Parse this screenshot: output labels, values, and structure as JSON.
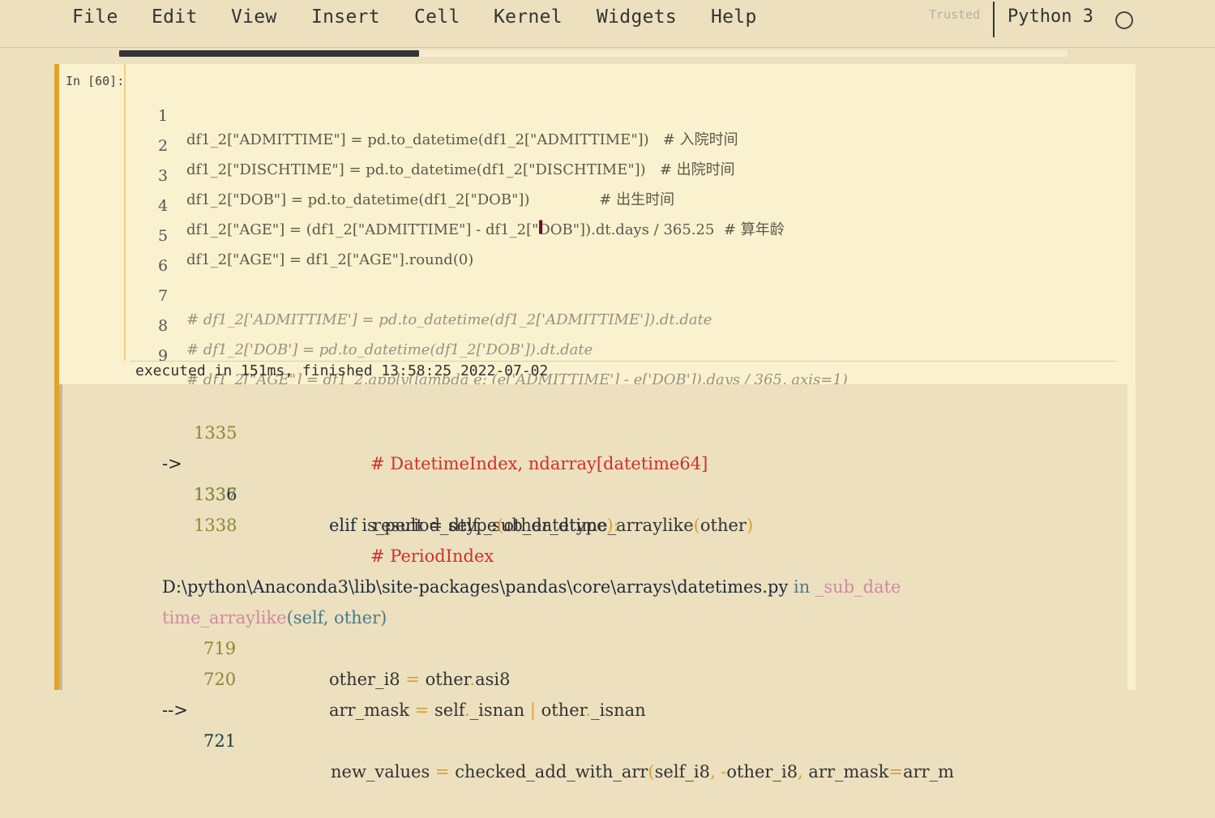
{
  "menu": [
    "File",
    "Edit",
    "View",
    "Insert",
    "Cell",
    "Kernel",
    "Widgets",
    "Help"
  ],
  "trusted": "Trusted",
  "kernel": {
    "name": "Python 3",
    "indicator_icon": "kernel-idle-circle-icon"
  },
  "cell": {
    "prompt": "In [60]:",
    "lines": [
      {
        "n": "1",
        "code": "df1_2[\"ADMITTIME\"] = pd.to_datetime(df1_2[\"ADMITTIME\"])   # 入院时间",
        "comment": false
      },
      {
        "n": "2",
        "code": "df1_2[\"DISCHTIME\"] = pd.to_datetime(df1_2[\"DISCHTIME\"])   # 出院时间",
        "comment": false
      },
      {
        "n": "3",
        "code": "df1_2[\"DOB\"] = pd.to_datetime(df1_2[\"DOB\"])               # 出生时间",
        "comment": false
      },
      {
        "n": "4",
        "code": "df1_2[\"AGE\"] = (df1_2[\"ADMITTIME\"] - df1_2[\"DOB\"]).dt.days / 365.25  # 算年龄",
        "comment": false
      },
      {
        "n": "5",
        "code": "df1_2[\"AGE\"] = df1_2[\"AGE\"].round(0)",
        "comment": false
      },
      {
        "n": "6",
        "code": "",
        "comment": false
      },
      {
        "n": "7",
        "code": "# df1_2['ADMITTIME'] = pd.to_datetime(df1_2['ADMITTIME']).dt.date",
        "comment": true
      },
      {
        "n": "8",
        "code": "# df1_2['DOB'] = pd.to_datetime(df1_2['DOB']).dt.date",
        "comment": true
      },
      {
        "n": "9",
        "code": "# df1_2[\"AGE\"] = df1_2.apply(lambda e: (e['ADMITTIME'] - e['DOB']).days / 365, axis=1)",
        "comment": true
      }
    ],
    "exec_info": "executed in 151ms, finished 13:58:25 2022-07-02"
  },
  "traceback": {
    "l1335_num": "1335",
    "l1335_code": "# DatetimeIndex, ndarray[datetime64]",
    "l1336_arrow": "->",
    "l1336_num": "1336",
    "l1336_a": "result = self",
    "l1336_b": ".",
    "l1336_c": "_sub_datetime_arraylike",
    "l1336_d": "(",
    "l1336_e": "other",
    "l1336_f": ")",
    "l1337_num": "1337",
    "l1337_a": "elif",
    "l1337_b": " is_period_dtype",
    "l1337_c": "(",
    "l1337_d": "other_dtype",
    "l1337_e": "):",
    "l1338_num": "1338",
    "l1338_code": "# PeriodIndex",
    "file_path": "D:\\python\\Anaconda3\\lib\\site-packages\\pandas\\core\\arrays\\datetimes.py",
    "file_in": " in ",
    "func_a": "_sub_date",
    "func_b": "time_arraylike",
    "func_args": "(self, other)",
    "l719_num": "719",
    "l719_a": "other_i8 ",
    "l719_b": "=",
    "l719_c": " other",
    "l719_d": ".",
    "l719_e": "asi8",
    "l720_num": "720",
    "l720_a": "arr_mask ",
    "l720_b": "=",
    "l720_c": " self",
    "l720_d": ".",
    "l720_e": "_isnan ",
    "l720_f": "|",
    "l720_g": " other",
    "l720_h": ".",
    "l720_i": "_isnan",
    "l721_arrow": "-->",
    "l721_num": "721",
    "l721_a": "new_values ",
    "l721_b": "=",
    "l721_c": " checked_add_with_arr",
    "l721_d": "(",
    "l721_e": "self_i8",
    "l721_f": ",",
    "l721_g": " -",
    "l721_h": "other_i8",
    "l721_i": ",",
    "l721_j": " arr_mask",
    "l721_k": "=",
    "l721_l": "arr_m"
  },
  "mouse_cursor_icon": "text-cursor-icon"
}
